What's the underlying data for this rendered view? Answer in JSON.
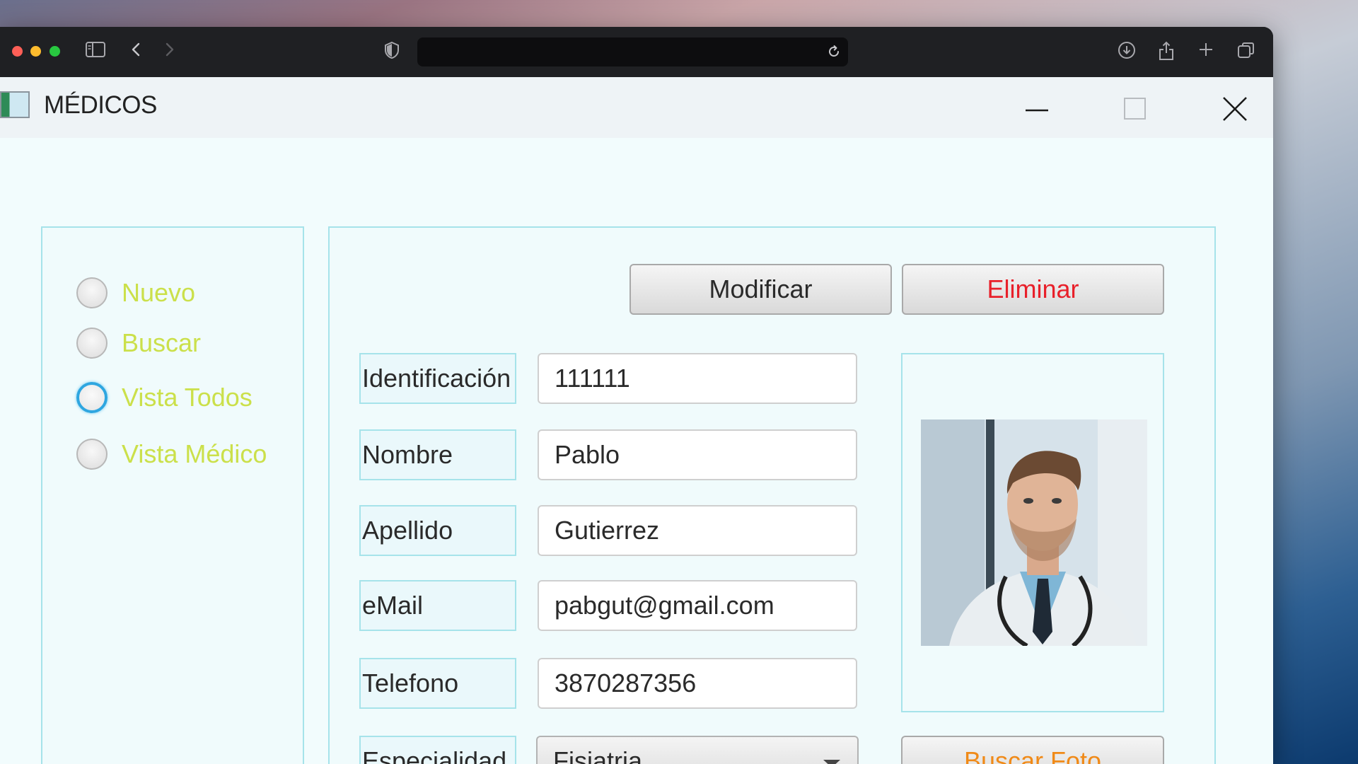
{
  "browser": {
    "address_text": ""
  },
  "window": {
    "title": "MÉDICOS"
  },
  "sidebar": {
    "options": [
      {
        "label": "Nuevo",
        "focused": false
      },
      {
        "label": "Buscar",
        "focused": false
      },
      {
        "label": "Vista Todos",
        "focused": true
      },
      {
        "label": "Vista Médico",
        "focused": false
      }
    ]
  },
  "actions": {
    "modify_label": "Modificar",
    "delete_label": "Eliminar",
    "find_photo_label": "Buscar Foto"
  },
  "form": {
    "fields": [
      {
        "label": "Identificación",
        "value": "111111"
      },
      {
        "label": "Nombre",
        "value": "Pablo"
      },
      {
        "label": "Apellido",
        "value": "Gutierrez"
      },
      {
        "label": "eMail",
        "value": "pabgut@gmail.com"
      },
      {
        "label": "Telefono",
        "value": "3870287356"
      }
    ],
    "specialty": {
      "label": "Especialidad",
      "value": "Fisiatria"
    }
  },
  "icons": [
    "sidebar-icon",
    "back-icon",
    "forward-icon",
    "shield-icon",
    "reload-icon",
    "download-icon",
    "share-icon",
    "new-tab-icon",
    "tabs-icon",
    "minimize-icon",
    "maximize-icon",
    "close-icon",
    "app-icon",
    "doctor-photo"
  ],
  "colors": {
    "radio_label": "#cbe04a",
    "delete_text": "#e8202a",
    "find_photo_text": "#f08a18",
    "panel_border": "#a6e3ea",
    "focus_ring": "#2ea6e0"
  }
}
